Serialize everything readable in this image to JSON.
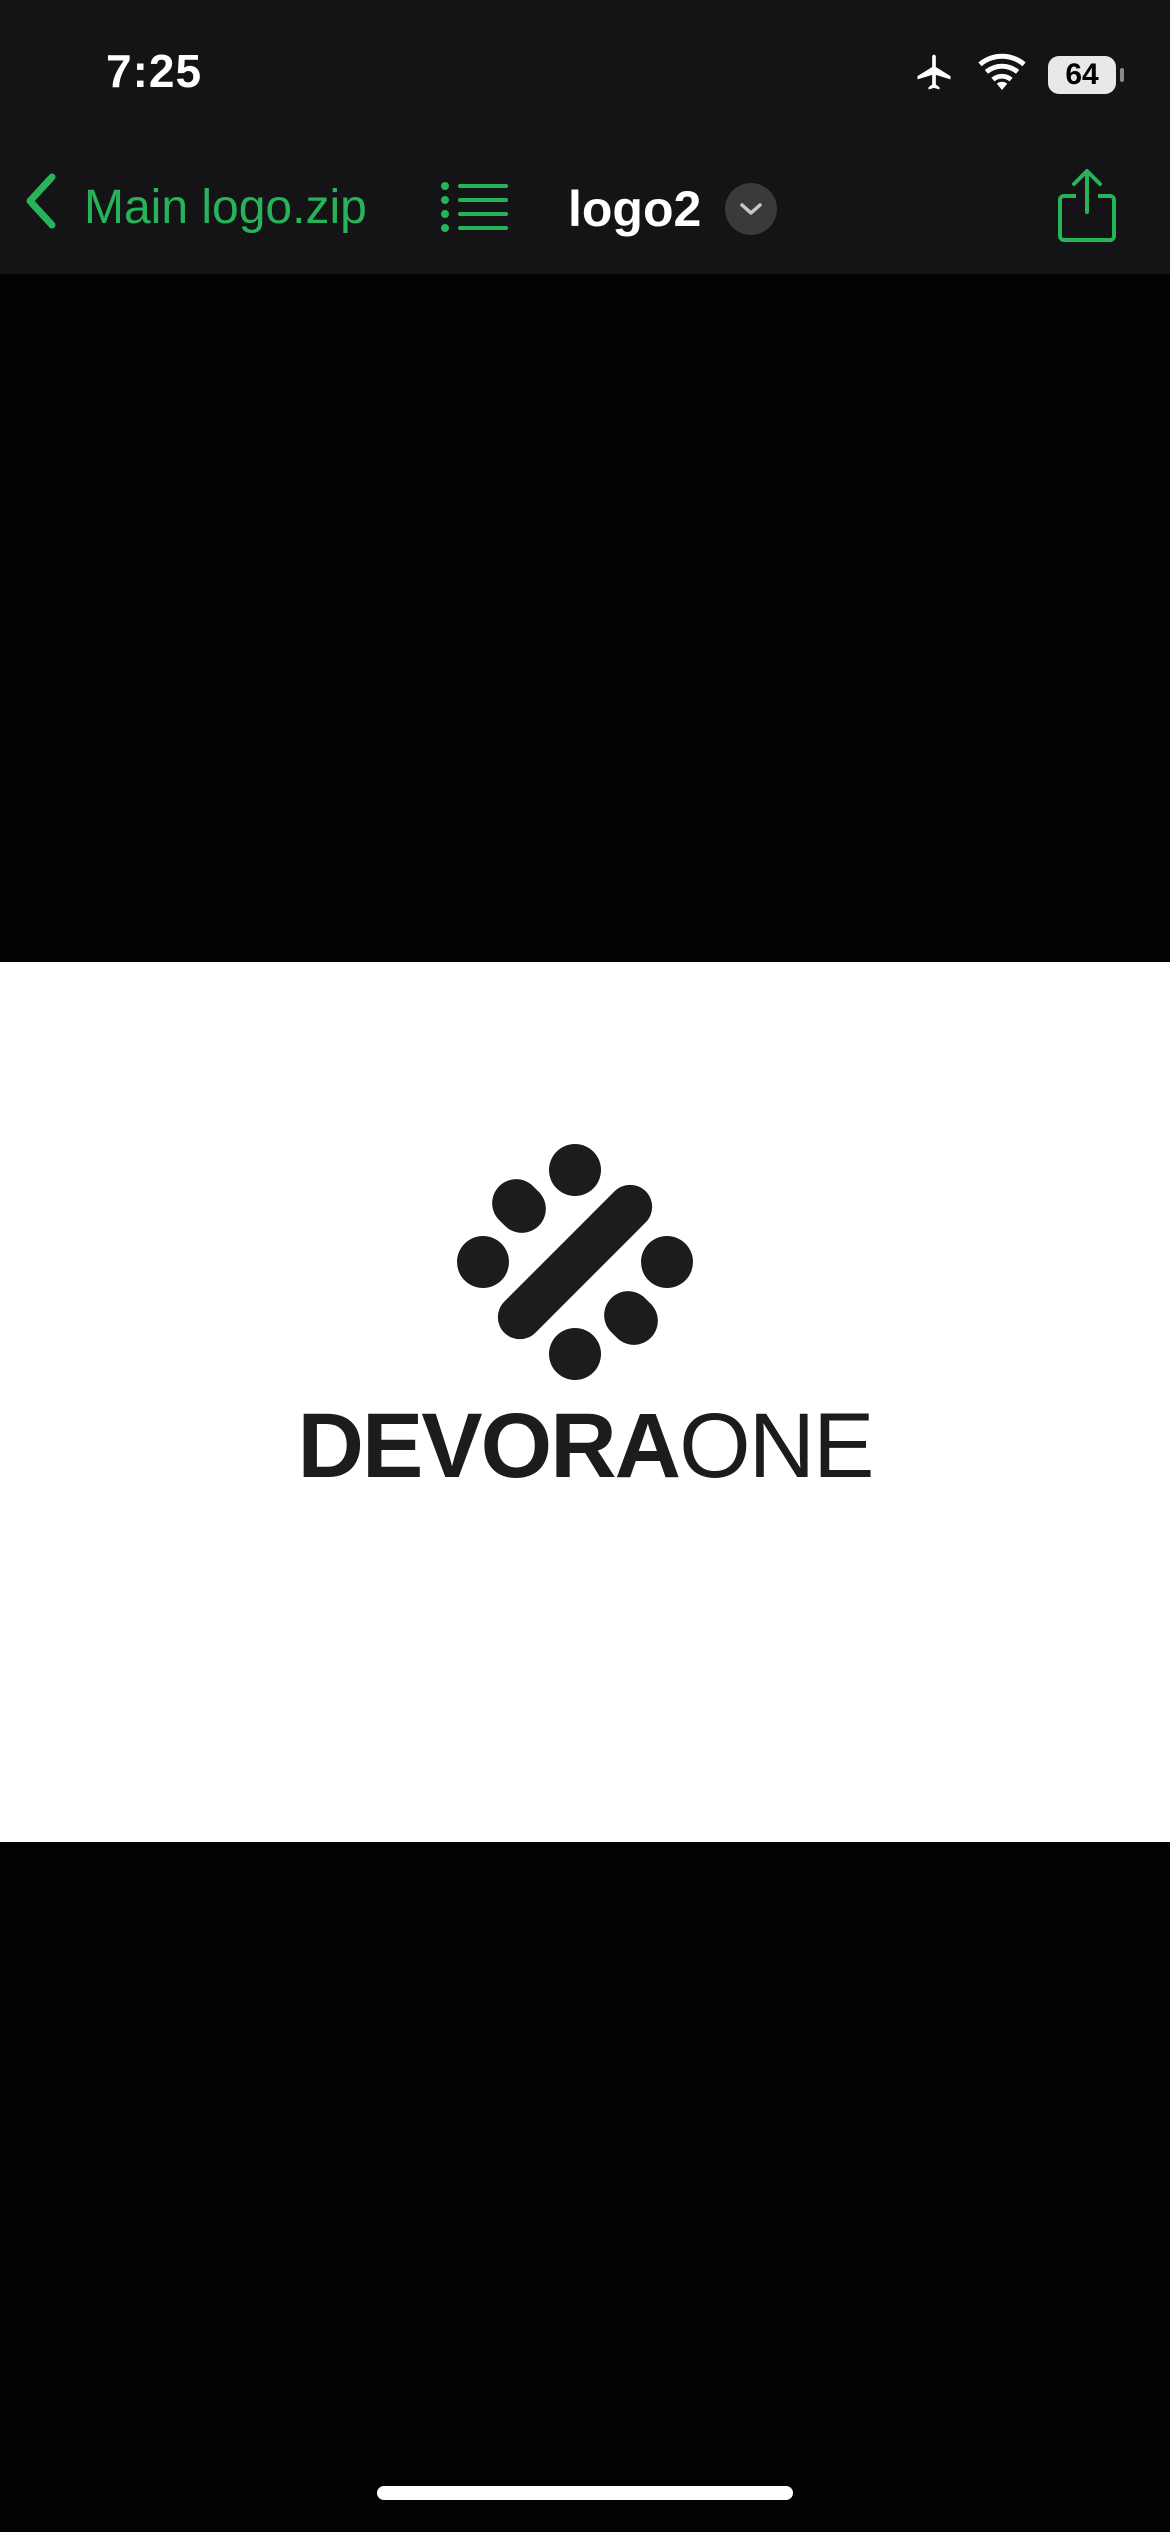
{
  "status_bar": {
    "time": "7:25",
    "battery": "64",
    "icons": [
      "airplane-icon",
      "wifi-icon",
      "battery-icon"
    ]
  },
  "nav": {
    "back_label": "Main logo.zip",
    "title": "logo2",
    "icons": [
      "chevron-left-icon",
      "list-icon",
      "chevron-down-icon",
      "share-icon"
    ]
  },
  "image": {
    "logo_text_bold": "DEVORA",
    "logo_text_light": "ONE"
  },
  "colors": {
    "accent": "#27b35a",
    "bar_bg": "#141416",
    "viewer_bg": "#030203",
    "logo": "#1c1c1e"
  }
}
